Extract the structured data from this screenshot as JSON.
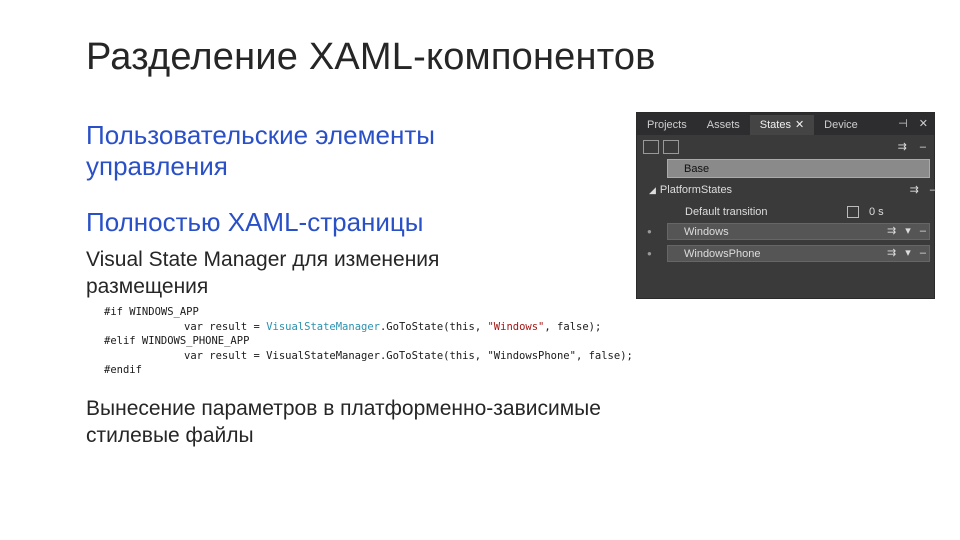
{
  "slide": {
    "title": "Разделение XAML-компонентов",
    "bullet1": "Пользовательские элементы управления",
    "bullet2": "Полностью XAML-страницы",
    "sub": "Visual State Manager для изменения размещения",
    "code": {
      "l1": "#if WINDOWS_APP",
      "l2_a": "var result = ",
      "l2_cls": "VisualStateManager",
      "l2_b": ".GoToState(",
      "l2_this": "this",
      "l2_c": ", ",
      "l2_str": "\"Windows\"",
      "l2_d": ", ",
      "l2_false": "false",
      "l2_e": ");",
      "l3": "#elif WINDOWS_PHONE_APP",
      "l4_a": "var result = VisualStateManager.GoToState(this, ",
      "l4_str": "\"WindowsPhone\"",
      "l4_b": ", false);",
      "l5": "#endif"
    },
    "bottom": "Вынесение параметров в платформенно-зависимые стилевые файлы"
  },
  "panel": {
    "tabs": [
      "Projects",
      "Assets",
      "States",
      "Device"
    ],
    "active_tab": "States",
    "tab_close": "✕",
    "ctrl_pin": "⊣",
    "ctrl_close": "✕",
    "toolbar_add": "⇉",
    "toolbar_minus": "–",
    "base_label": "Base",
    "group_label": "PlatformStates",
    "group_add": "⇉",
    "group_minus": "–",
    "transition_label": "Default transition",
    "transition_time": "0 s",
    "states": [
      {
        "label": "Windows",
        "add": "⇉",
        "menu": "▾",
        "minus": "–"
      },
      {
        "label": "WindowsPhone",
        "add": "⇉",
        "menu": "▾",
        "minus": "–"
      }
    ]
  }
}
